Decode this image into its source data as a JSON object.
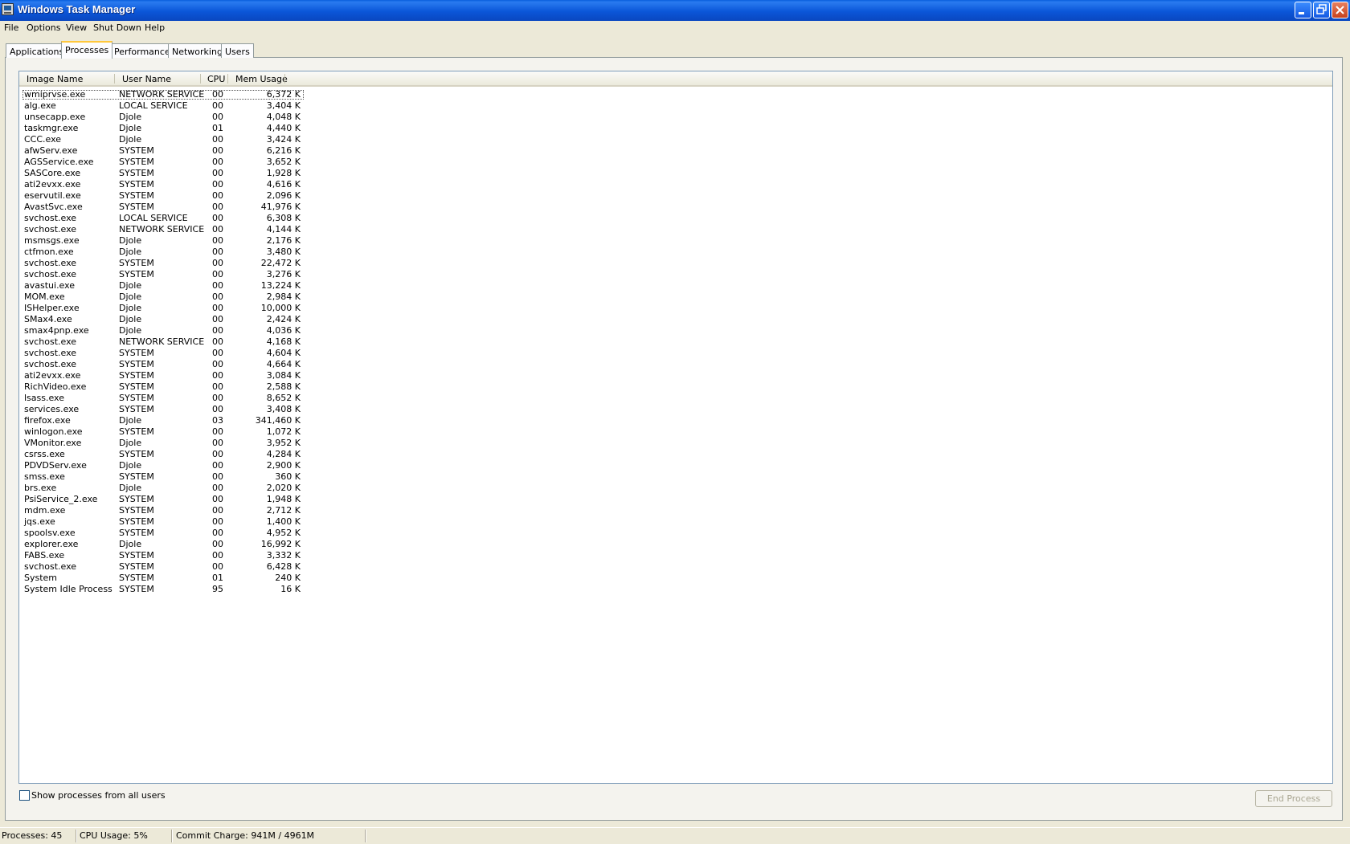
{
  "window": {
    "title": "Windows Task Manager"
  },
  "menu": [
    "File",
    "Options",
    "View",
    "Shut Down",
    "Help"
  ],
  "tabs": [
    "Applications",
    "Processes",
    "Performance",
    "Networking",
    "Users"
  ],
  "active_tab": "Processes",
  "columns": [
    "Image Name",
    "User Name",
    "CPU",
    "Mem Usage"
  ],
  "processes": [
    [
      "wmiprvse.exe",
      "NETWORK SERVICE",
      "00",
      "6,372 K"
    ],
    [
      "alg.exe",
      "LOCAL SERVICE",
      "00",
      "3,404 K"
    ],
    [
      "unsecapp.exe",
      "Djole",
      "00",
      "4,048 K"
    ],
    [
      "taskmgr.exe",
      "Djole",
      "01",
      "4,440 K"
    ],
    [
      "CCC.exe",
      "Djole",
      "00",
      "3,424 K"
    ],
    [
      "afwServ.exe",
      "SYSTEM",
      "00",
      "6,216 K"
    ],
    [
      "AGSService.exe",
      "SYSTEM",
      "00",
      "3,652 K"
    ],
    [
      "SASCore.exe",
      "SYSTEM",
      "00",
      "1,928 K"
    ],
    [
      "ati2evxx.exe",
      "SYSTEM",
      "00",
      "4,616 K"
    ],
    [
      "eservutil.exe",
      "SYSTEM",
      "00",
      "2,096 K"
    ],
    [
      "AvastSvc.exe",
      "SYSTEM",
      "00",
      "41,976 K"
    ],
    [
      "svchost.exe",
      "LOCAL SERVICE",
      "00",
      "6,308 K"
    ],
    [
      "svchost.exe",
      "NETWORK SERVICE",
      "00",
      "4,144 K"
    ],
    [
      "msmsgs.exe",
      "Djole",
      "00",
      "2,176 K"
    ],
    [
      "ctfmon.exe",
      "Djole",
      "00",
      "3,480 K"
    ],
    [
      "svchost.exe",
      "SYSTEM",
      "00",
      "22,472 K"
    ],
    [
      "svchost.exe",
      "SYSTEM",
      "00",
      "3,276 K"
    ],
    [
      "avastui.exe",
      "Djole",
      "00",
      "13,224 K"
    ],
    [
      "MOM.exe",
      "Djole",
      "00",
      "2,984 K"
    ],
    [
      "ISHelper.exe",
      "Djole",
      "00",
      "10,000 K"
    ],
    [
      "SMax4.exe",
      "Djole",
      "00",
      "2,424 K"
    ],
    [
      "smax4pnp.exe",
      "Djole",
      "00",
      "4,036 K"
    ],
    [
      "svchost.exe",
      "NETWORK SERVICE",
      "00",
      "4,168 K"
    ],
    [
      "svchost.exe",
      "SYSTEM",
      "00",
      "4,604 K"
    ],
    [
      "svchost.exe",
      "SYSTEM",
      "00",
      "4,664 K"
    ],
    [
      "ati2evxx.exe",
      "SYSTEM",
      "00",
      "3,084 K"
    ],
    [
      "RichVideo.exe",
      "SYSTEM",
      "00",
      "2,588 K"
    ],
    [
      "lsass.exe",
      "SYSTEM",
      "00",
      "8,652 K"
    ],
    [
      "services.exe",
      "SYSTEM",
      "00",
      "3,408 K"
    ],
    [
      "firefox.exe",
      "Djole",
      "03",
      "341,460 K"
    ],
    [
      "winlogon.exe",
      "SYSTEM",
      "00",
      "1,072 K"
    ],
    [
      "VMonitor.exe",
      "Djole",
      "00",
      "3,952 K"
    ],
    [
      "csrss.exe",
      "SYSTEM",
      "00",
      "4,284 K"
    ],
    [
      "PDVDServ.exe",
      "Djole",
      "00",
      "2,900 K"
    ],
    [
      "smss.exe",
      "SYSTEM",
      "00",
      "360 K"
    ],
    [
      "brs.exe",
      "Djole",
      "00",
      "2,020 K"
    ],
    [
      "PsiService_2.exe",
      "SYSTEM",
      "00",
      "1,948 K"
    ],
    [
      "mdm.exe",
      "SYSTEM",
      "00",
      "2,712 K"
    ],
    [
      "jqs.exe",
      "SYSTEM",
      "00",
      "1,400 K"
    ],
    [
      "spoolsv.exe",
      "SYSTEM",
      "00",
      "4,952 K"
    ],
    [
      "explorer.exe",
      "Djole",
      "00",
      "16,992 K"
    ],
    [
      "FABS.exe",
      "SYSTEM",
      "00",
      "3,332 K"
    ],
    [
      "svchost.exe",
      "SYSTEM",
      "00",
      "6,428 K"
    ],
    [
      "System",
      "SYSTEM",
      "01",
      "240 K"
    ],
    [
      "System Idle Process",
      "SYSTEM",
      "95",
      "16 K"
    ]
  ],
  "show_all_label": "Show processes from all users",
  "show_all_checked": false,
  "end_process_label": "End Process",
  "status": {
    "processes": "Processes: 45",
    "cpu_usage": "CPU Usage: 5%",
    "commit_charge": "Commit Charge: 941M / 4961M"
  },
  "caption_buttons": {
    "minimize": "minimize-icon",
    "restore": "restore-icon",
    "close": "close-icon"
  }
}
